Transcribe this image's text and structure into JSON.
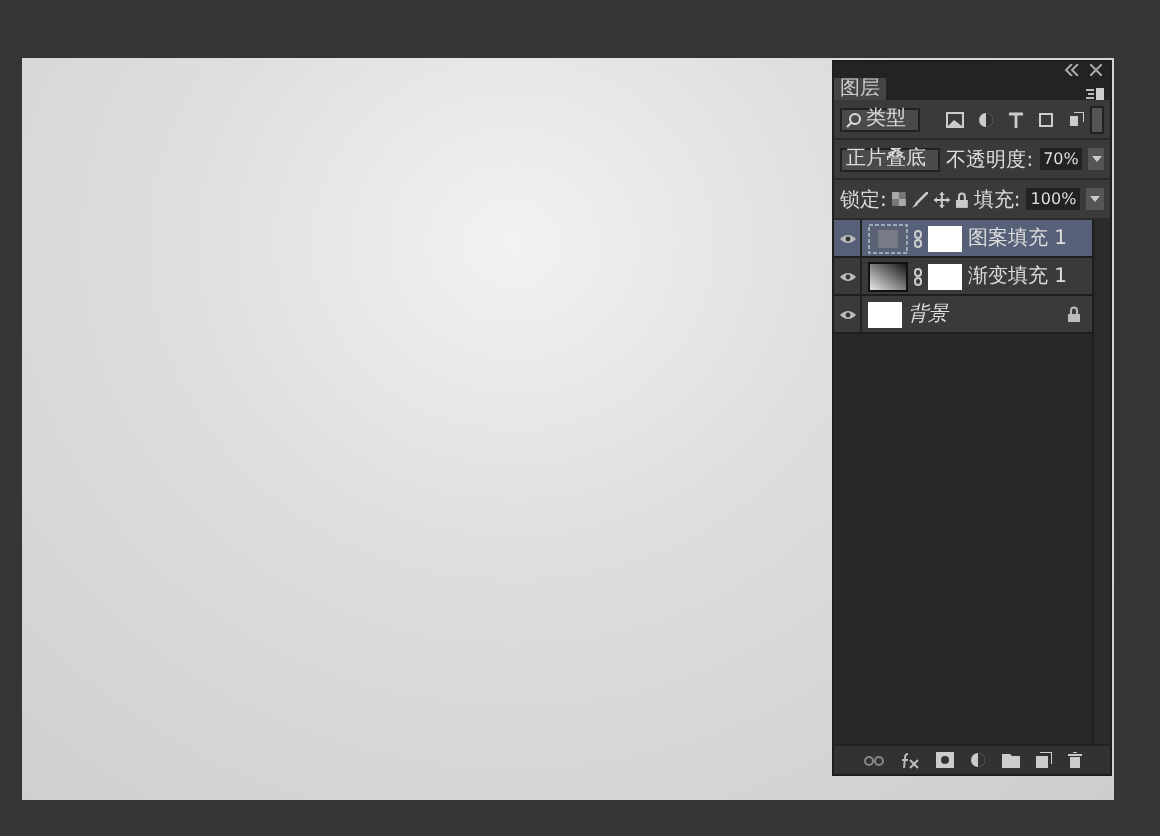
{
  "panel": {
    "tab": "图层",
    "filter": "类型",
    "blend_mode": "正片叠底",
    "opacity_label": "不透明度:",
    "opacity": "70%",
    "lock_label": "锁定:",
    "fill_label": "填充:",
    "fill": "100%"
  },
  "layers": [
    {
      "name": "图案填充 1",
      "kind": "pattern",
      "selected": true,
      "visible": true,
      "locked": false
    },
    {
      "name": "渐变填充 1",
      "kind": "gradient",
      "selected": false,
      "visible": true,
      "locked": false
    },
    {
      "name": "背景",
      "kind": "background",
      "selected": false,
      "visible": true,
      "locked": true
    }
  ]
}
